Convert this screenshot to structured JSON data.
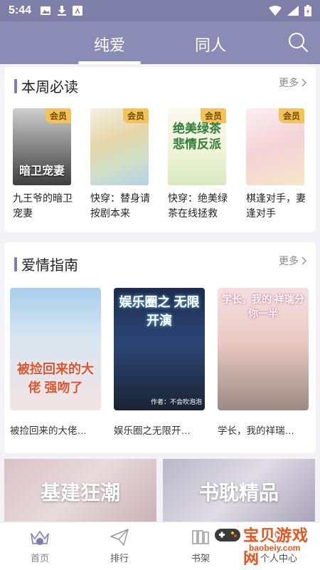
{
  "status_bar": {
    "time": "5:44"
  },
  "header": {
    "tabs": [
      {
        "label": "纯爱",
        "active": true
      },
      {
        "label": "同人",
        "active": false
      }
    ],
    "accent_color": "#8a8cb6"
  },
  "weekly": {
    "title": "本周必读",
    "more": "更多",
    "books": [
      {
        "title": "九王爷的暗卫宠妻",
        "badge": "会员",
        "cover_text": "暗卫宠妻"
      },
      {
        "title": "快穿：替身请按剧本来",
        "badge": "会员",
        "cover_text": ""
      },
      {
        "title": "快穿：绝美绿茶在线拯救",
        "badge": "会员",
        "cover_text": "绝美绿茶 悲情反派"
      },
      {
        "title": "棋逢对手，妻逢对手",
        "badge": "会员",
        "cover_text": ""
      }
    ]
  },
  "love_guide": {
    "title": "爱情指南",
    "more": "更多",
    "books": [
      {
        "title": "被捡回来的大佬…",
        "cover_text": "被捡回来的大佬 强吻了",
        "cover_author": ""
      },
      {
        "title": "娱乐圈之无限开…",
        "cover_text": "娱乐圈之 无限开演",
        "cover_author": "作者：不会吹泡泡"
      },
      {
        "title": "学长，我的祥瑞…",
        "cover_text": "学长，我的 祥瑞分你一半",
        "cover_author": ""
      }
    ]
  },
  "banners": [
    {
      "label": "基建狂潮"
    },
    {
      "label": "书耽精品"
    }
  ],
  "bottom_nav": [
    {
      "label": "首页",
      "icon": "crown-icon",
      "active": true
    },
    {
      "label": "排行",
      "icon": "paper-plane-icon",
      "active": false
    },
    {
      "label": "书架",
      "icon": "bookshelf-icon",
      "active": false
    },
    {
      "label": "个人中心",
      "icon": "person-icon",
      "active": false
    }
  ],
  "watermark": {
    "text": "宝贝游戏网",
    "url": "baobeiy.com"
  }
}
